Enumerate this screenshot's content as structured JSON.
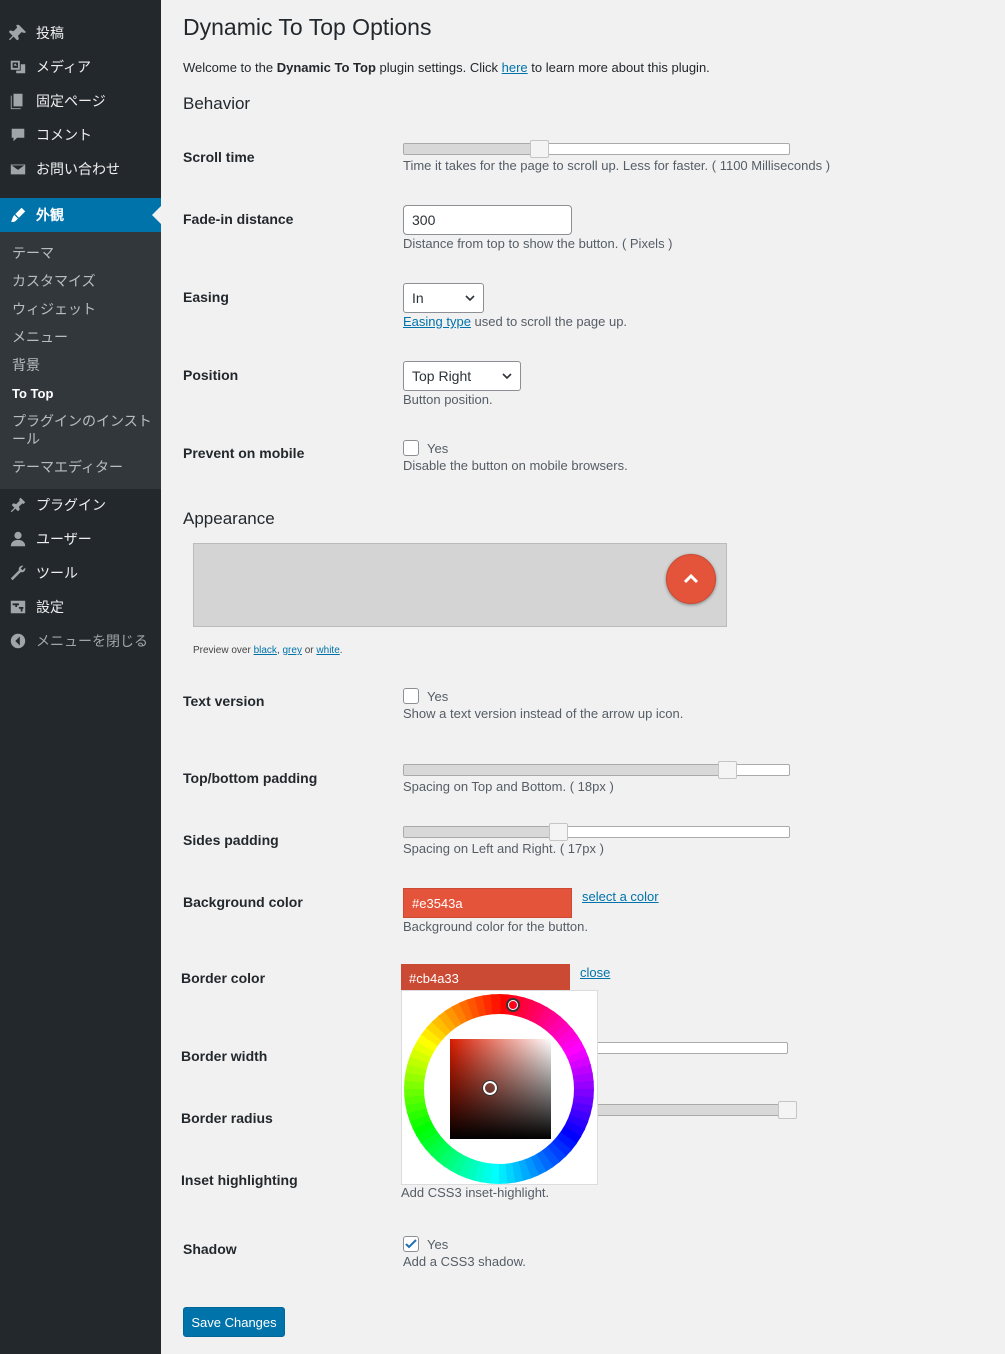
{
  "sidebar": {
    "items": [
      {
        "label": "投稿",
        "icon": "pin-icon"
      },
      {
        "label": "メディア",
        "icon": "media-icon"
      },
      {
        "label": "固定ページ",
        "icon": "page-icon"
      },
      {
        "label": "コメント",
        "icon": "comment-icon"
      },
      {
        "label": "お問い合わせ",
        "icon": "mail-icon"
      },
      {
        "label": "外観",
        "icon": "brush-icon"
      }
    ],
    "submenu": [
      "テーマ",
      "カスタマイズ",
      "ウィジェット",
      "メニュー",
      "背景",
      "To Top",
      "プラグインのインストール",
      "テーマエディター"
    ],
    "items2": [
      {
        "label": "プラグイン",
        "icon": "plugin-icon"
      },
      {
        "label": "ユーザー",
        "icon": "user-icon"
      },
      {
        "label": "ツール",
        "icon": "wrench-icon"
      },
      {
        "label": "設定",
        "icon": "settings-icon"
      }
    ],
    "collapse_label": "メニューを閉じる"
  },
  "page": {
    "title": "Dynamic To Top Options",
    "welcome_pre": "Welcome to the ",
    "welcome_bold": "Dynamic To Top",
    "welcome_mid": " plugin settings. Click ",
    "welcome_link": "here",
    "welcome_post": " to learn more about this plugin."
  },
  "behavior": {
    "title": "Behavior",
    "scroll_time": {
      "label": "Scroll time",
      "desc": "Time it takes for the page to scroll up. Less for faster. ( 1100 Milliseconds )",
      "value": 0.35
    },
    "fade_in": {
      "label": "Fade-in distance",
      "value": "300",
      "desc": "Distance from top to show the button. ( Pixels )"
    },
    "easing": {
      "label": "Easing",
      "value": "In",
      "link": "Easing type",
      "desc": " used to scroll the page up."
    },
    "position": {
      "label": "Position",
      "value": "Top Right",
      "desc": "Button position."
    },
    "prevent_mobile": {
      "label": "Prevent on mobile",
      "check": "Yes",
      "desc": "Disable the button on mobile browsers."
    }
  },
  "appearance": {
    "title": "Appearance",
    "preview_pre": "Preview over ",
    "preview_black": "black",
    "preview_comma": ", ",
    "preview_grey": "grey",
    "preview_or": " or ",
    "preview_white": "white",
    "preview_end": ".",
    "text_version": {
      "label": "Text version",
      "check": "Yes",
      "desc": "Show a text version instead of the arrow up icon."
    },
    "tb_padding": {
      "label": "Top/bottom padding",
      "desc": "Spacing on Top and Bottom. ( 18px )",
      "value": 0.84
    },
    "sides_padding": {
      "label": "Sides padding",
      "desc": "Spacing on Left and Right. ( 17px )",
      "value": 0.4
    },
    "bg_color": {
      "label": "Background color",
      "value": "#e3543a",
      "link": "select a color",
      "desc": "Background color for the button."
    },
    "border_color": {
      "label": "Border color",
      "value": "#cb4a33",
      "link": "close"
    },
    "border_width": {
      "label": "Border width"
    },
    "border_radius": {
      "label": "Border radius"
    },
    "inset": {
      "label": "Inset highlighting",
      "desc": "Add CSS3 inset-highlight."
    },
    "shadow": {
      "label": "Shadow",
      "check": "Yes",
      "desc": "Add a CSS3 shadow."
    }
  },
  "save_label": "Save Changes",
  "colors": {
    "accent": "#0073aa",
    "button_bg": "#e3543a",
    "button_border": "#cb4a33"
  }
}
